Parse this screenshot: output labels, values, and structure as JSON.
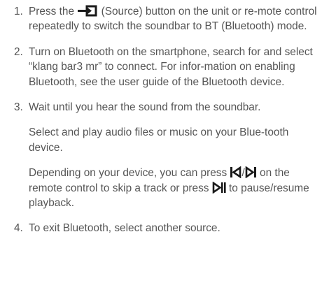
{
  "steps": [
    {
      "number": "1.",
      "text_before_icon": "Press the ",
      "icon": "source-input-icon",
      "text_after_icon": " (Source) button on the unit or re-mote control repeatedly to switch the soundbar to BT (Bluetooth) mode."
    },
    {
      "number": "2.",
      "text": "Turn on Bluetooth on the smartphone, search for and select “klang bar3 mr” to connect. For infor-mation on enabling Bluetooth, see the user guide of the Bluetooth device."
    },
    {
      "number": "3.",
      "text": "Wait until you hear the sound from the soundbar.",
      "para2": "Select and play audio files or music on your Blue-tooth device.",
      "para3_a": "Depending on your device, you can press ",
      "icon_prev": "skip-previous-icon",
      "separator": "/",
      "icon_next": "skip-next-icon",
      "para3_b": " on the remote control to skip a track or press ",
      "icon_playpause": "play-pause-icon",
      "para3_c": " to pause/resume playback."
    },
    {
      "number": "4.",
      "text": "To exit Bluetooth, select another source."
    }
  ],
  "colors": {
    "text": "#555555",
    "icon": "#1a1a1a"
  }
}
